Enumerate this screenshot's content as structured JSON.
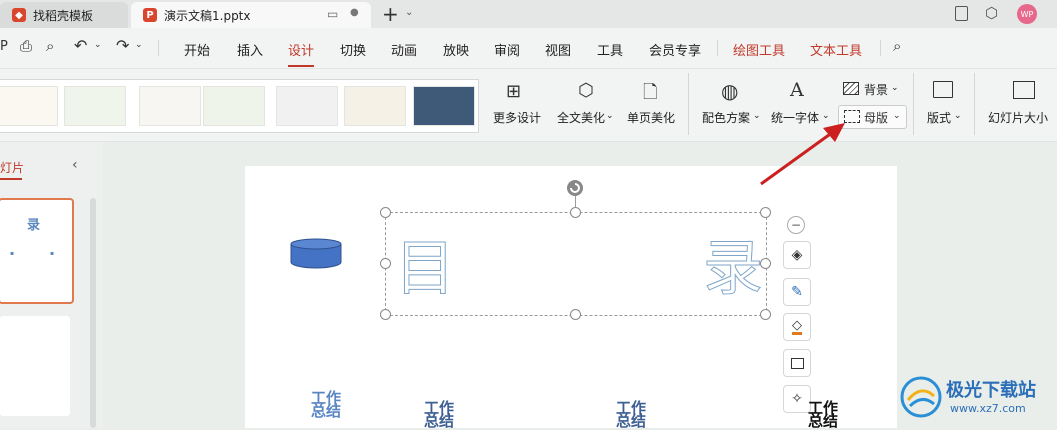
{
  "titlebar": {
    "tabs": [
      {
        "label": "找稻壳模板",
        "active": false
      },
      {
        "label": "演示文稿1.pptx",
        "active": true
      }
    ],
    "avatar_text": "WP"
  },
  "menubar": {
    "items": [
      "开始",
      "插入",
      "设计",
      "切换",
      "动画",
      "放映",
      "审阅",
      "视图",
      "工具",
      "会员专享",
      "绘图工具",
      "文本工具"
    ],
    "active": "设计"
  },
  "ribbon": {
    "more_design": "更多设计",
    "full_beautify": "全文美化",
    "page_beautify": "单页美化",
    "color_scheme": "配色方案",
    "unify_font": "统一字体",
    "background": "背景",
    "master": "母版",
    "layout": "版式",
    "slide_size": "幻灯片大小"
  },
  "leftpanel": {
    "tab_label": "灯片",
    "thumb_char": "录"
  },
  "slide": {
    "title_left": "目",
    "title_right": "录",
    "work_summary": "工作总结"
  },
  "watermark": {
    "brand": "极光下载站",
    "url": "www.xz7.com"
  },
  "colors": {
    "accent_red": "#c0392b",
    "shape_blue": "#4472c4",
    "arrow_red": "#cc1f1f"
  }
}
